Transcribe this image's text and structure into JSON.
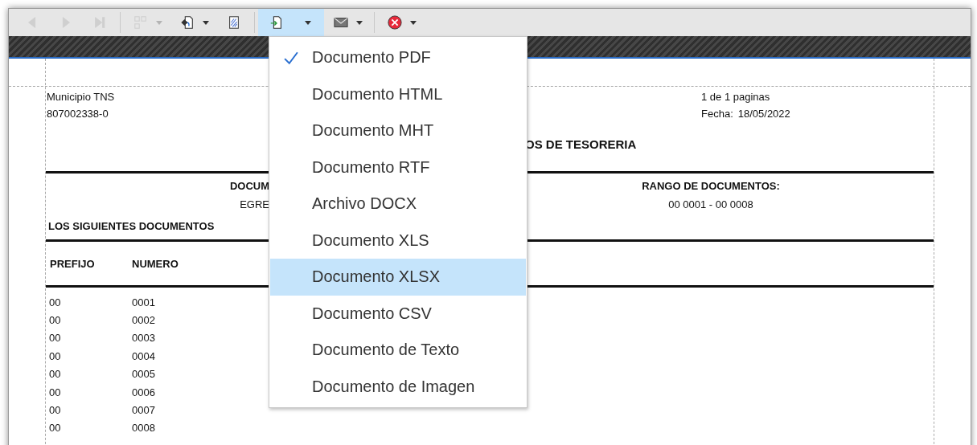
{
  "toolbar": {
    "groups": [
      {
        "buttons": [
          {
            "kind": "back",
            "disabled": true,
            "dropdown": false,
            "pressed": false
          },
          {
            "kind": "forward",
            "disabled": true,
            "dropdown": false,
            "pressed": false
          },
          {
            "kind": "last",
            "disabled": true,
            "dropdown": false,
            "pressed": false
          }
        ]
      },
      {
        "buttons": [
          {
            "kind": "layout",
            "disabled": true,
            "dropdown": true,
            "pressed": false
          },
          {
            "kind": "open",
            "disabled": false,
            "dropdown": true,
            "pressed": false
          },
          {
            "kind": "page-setup",
            "disabled": false,
            "dropdown": false,
            "pressed": false
          }
        ]
      },
      {
        "buttons": [
          {
            "kind": "export",
            "disabled": false,
            "dropdown": true,
            "pressed": true
          },
          {
            "kind": "email",
            "disabled": false,
            "dropdown": true,
            "pressed": false
          }
        ]
      },
      {
        "buttons": [
          {
            "kind": "close",
            "disabled": false,
            "dropdown": true,
            "pressed": false
          }
        ]
      }
    ]
  },
  "report": {
    "company": "Municipio TNS",
    "nit": "807002338-0",
    "pages": "1 de 1 paginas",
    "date_label": "Fecha:",
    "date": "18/05/2022",
    "title": "OS DE TESORERIA",
    "doc_type_label": "DOCUM",
    "doc_type": "EGRE",
    "range_label": "RANGO DE DOCUMENTOS:",
    "range": "00 0001 - 00 0008",
    "note": "LOS SIGUIENTES DOCUMENTOS",
    "columns": [
      "PREFIJO",
      "NUMERO"
    ],
    "rows": [
      [
        "00",
        "0001"
      ],
      [
        "00",
        "0002"
      ],
      [
        "00",
        "0003"
      ],
      [
        "00",
        "0004"
      ],
      [
        "00",
        "0005"
      ],
      [
        "00",
        "0006"
      ],
      [
        "00",
        "0007"
      ],
      [
        "00",
        "0008"
      ]
    ]
  },
  "export_menu": {
    "items": [
      {
        "label": "Documento PDF",
        "checked": true,
        "selected": false
      },
      {
        "label": "Documento HTML",
        "checked": false,
        "selected": false
      },
      {
        "label": "Documento MHT",
        "checked": false,
        "selected": false
      },
      {
        "label": "Documento RTF",
        "checked": false,
        "selected": false
      },
      {
        "label": "Archivo DOCX",
        "checked": false,
        "selected": false
      },
      {
        "label": "Documento XLS",
        "checked": false,
        "selected": false
      },
      {
        "label": "Documento XLSX",
        "checked": false,
        "selected": true
      },
      {
        "label": "Documento CSV",
        "checked": false,
        "selected": false
      },
      {
        "label": "Documento de Texto",
        "checked": false,
        "selected": false
      },
      {
        "label": "Documento de Imagen",
        "checked": false,
        "selected": false
      }
    ]
  }
}
